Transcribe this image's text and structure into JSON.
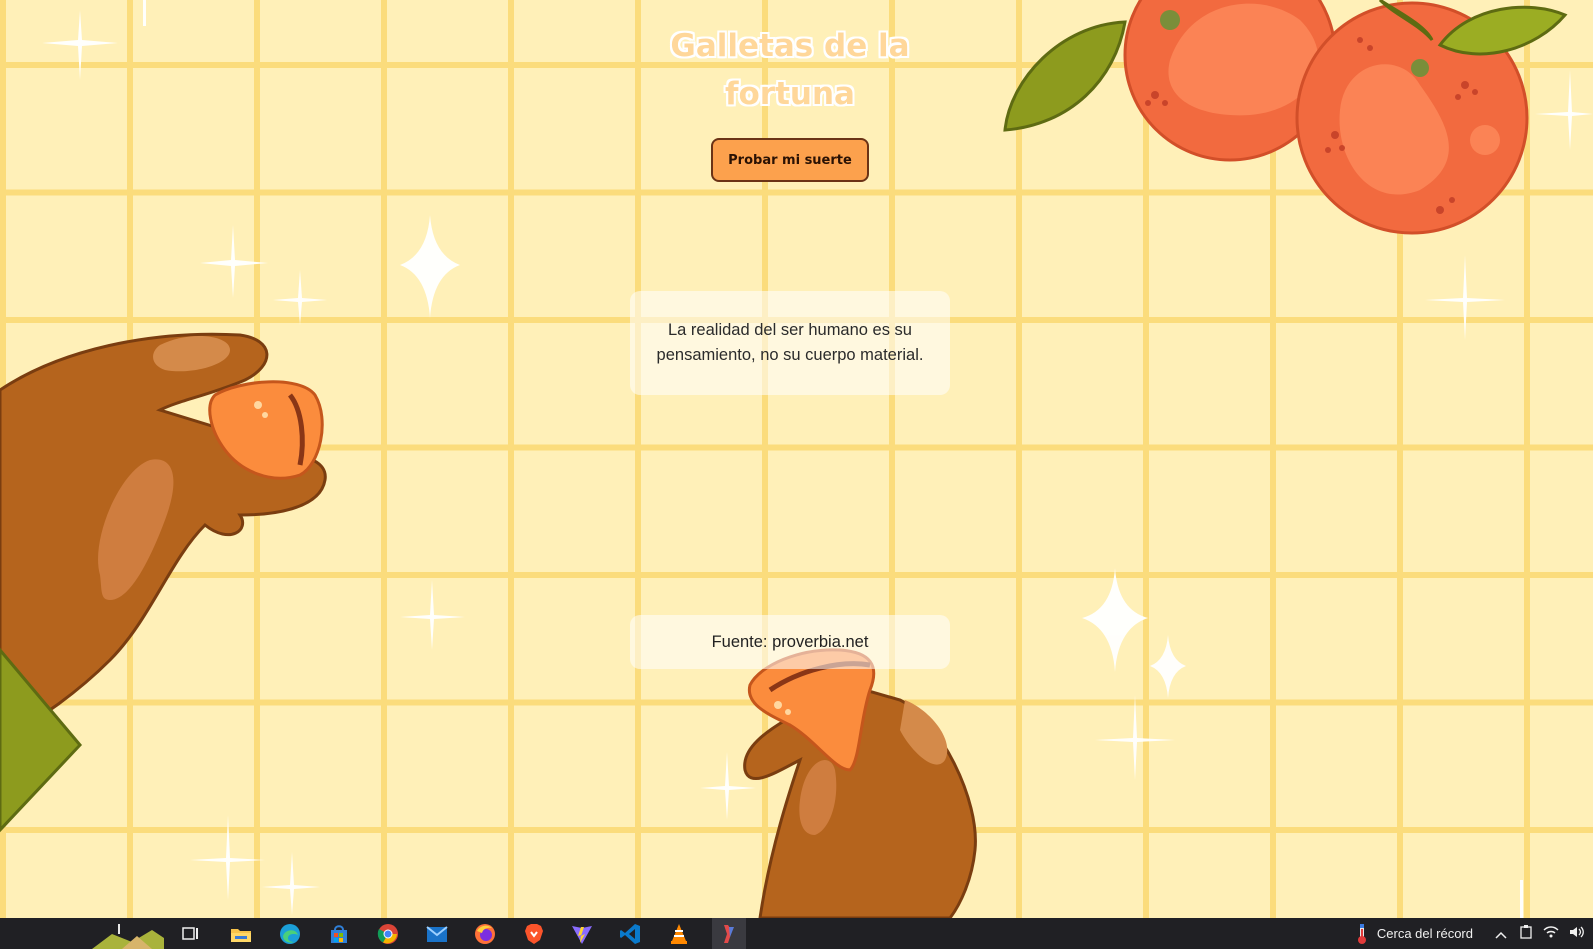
{
  "page": {
    "title": "Galletas de la fortuna",
    "button_label": "Probar mi suerte",
    "quote": "La realidad del ser humano es su pensamiento, no su cuerpo material.",
    "source": "Fuente: proverbia.net"
  },
  "colors": {
    "background": "#fff0b8",
    "grid": "#fbdc7c",
    "button": "#fca14d",
    "orange_fruit": "#f26a3f",
    "skin": "#b5641d",
    "taskbar": "#202024"
  },
  "taskbar": {
    "apps": [
      {
        "name": "task-view-icon"
      },
      {
        "name": "file-explorer-icon"
      },
      {
        "name": "edge-icon"
      },
      {
        "name": "store-icon"
      },
      {
        "name": "chrome-icon"
      },
      {
        "name": "mail-icon"
      },
      {
        "name": "firefox-icon"
      },
      {
        "name": "brave-icon"
      },
      {
        "name": "vite-icon"
      },
      {
        "name": "vscode-icon"
      },
      {
        "name": "vlc-icon"
      },
      {
        "name": "active-app-icon"
      }
    ],
    "weather_text": "Cerca del récord"
  }
}
